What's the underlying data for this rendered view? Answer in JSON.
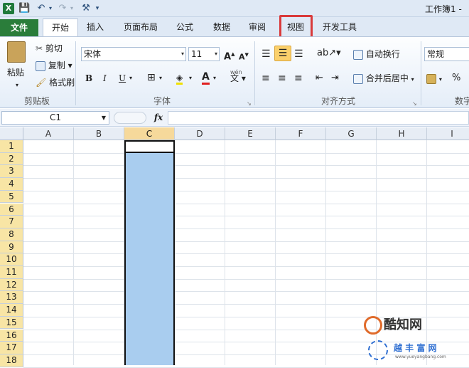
{
  "window": {
    "title": "工作簿1 - "
  },
  "qat": {
    "excel": "X",
    "save": "💾",
    "undo": "↶",
    "redo": "↷",
    "customize": "▾"
  },
  "tabs": [
    {
      "label": "文件"
    },
    {
      "label": "开始"
    },
    {
      "label": "插入"
    },
    {
      "label": "页面布局"
    },
    {
      "label": "公式"
    },
    {
      "label": "数据"
    },
    {
      "label": "审阅"
    },
    {
      "label": "视图"
    },
    {
      "label": "开发工具"
    }
  ],
  "ribbon": {
    "clipboard": {
      "paste": "粘贴",
      "cut": "剪切",
      "copy": "复制",
      "format_painter": "格式刷",
      "label": "剪贴板"
    },
    "font": {
      "name": "宋体",
      "size": "11",
      "grow": "A",
      "shrink": "A",
      "bold": "B",
      "italic": "I",
      "underline": "U",
      "label": "字体",
      "phonetic": "wén"
    },
    "alignment": {
      "wrap": "自动换行",
      "merge": "合并后居中",
      "label": "对齐方式"
    },
    "number": {
      "format": "常规",
      "percent": "%",
      "label": "数字"
    }
  },
  "formula_bar": {
    "name_box": "C1",
    "fx": "fx",
    "value": ""
  },
  "columns": [
    "A",
    "B",
    "C",
    "D",
    "E",
    "F",
    "G",
    "H",
    "I"
  ],
  "rows": [
    "1",
    "2",
    "3",
    "4",
    "5",
    "6",
    "7",
    "8",
    "9",
    "10",
    "11",
    "12",
    "13",
    "14",
    "15",
    "16",
    "17",
    "18"
  ],
  "watermark": {
    "brand": "酷知网",
    "site": "越 丰 富 网",
    "url": "www.yueyangbang.com"
  },
  "colors": {
    "file_tab": "#2a7d3a",
    "highlight": "#d93a3a",
    "selection": "#a9cdef",
    "selected_header": "#f6d99b"
  }
}
